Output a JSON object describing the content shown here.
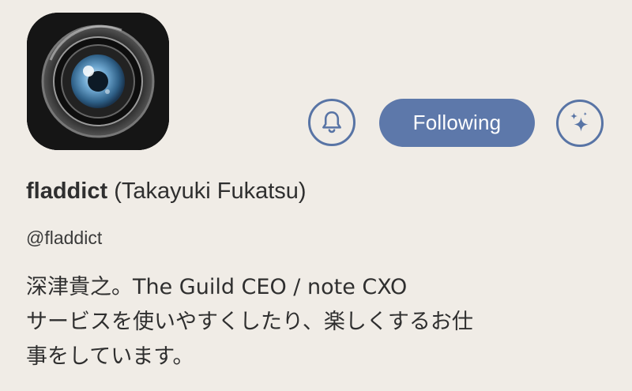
{
  "profile": {
    "display_name": "fladdict",
    "real_name": "(Takayuki Fukatsu)",
    "handle": "@fladdict",
    "bio_lines": [
      "深津貴之。The Guild CEO / note CXO",
      "サービスを使いやすくしたり、楽しくするお仕",
      "事をしています。"
    ],
    "avatar_icon": "camera-lens-icon"
  },
  "actions": {
    "follow_label": "Following",
    "notify_icon": "bell-icon",
    "ai_icon": "sparkle-icon"
  },
  "colors": {
    "background": "#f0ece6",
    "accent": "#5d78aa",
    "text": "#2f2f2f"
  }
}
